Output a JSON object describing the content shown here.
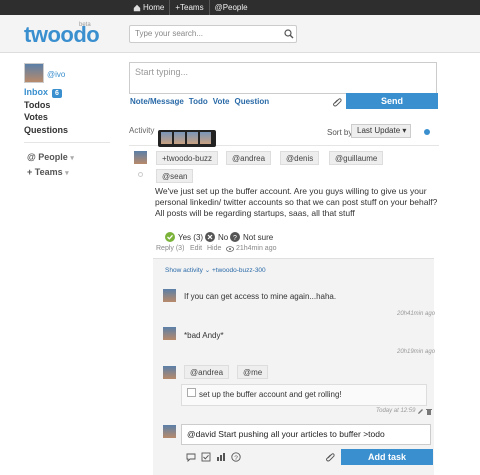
{
  "topnav": {
    "home": "Home",
    "teams": "+Teams",
    "people": "@People"
  },
  "header": {
    "logo": "twoodo",
    "beta": "beta",
    "search_placeholder": "Type your search..."
  },
  "user": {
    "handle": "@ivo"
  },
  "sidebar": {
    "inbox_label": "Inbox",
    "inbox_count": "6",
    "items": [
      "Todos",
      "Votes",
      "Questions"
    ],
    "people": "@ People",
    "teams": "+ Teams",
    "arrow": "▾"
  },
  "composer": {
    "placeholder": "Start typing...",
    "tabs": [
      "Note/Message",
      "Todo",
      "Vote",
      "Question"
    ],
    "send": "Send"
  },
  "activity": {
    "label": "Activity",
    "sort_label": "Sort by:",
    "sort_value": "Last Update ▾"
  },
  "post": {
    "tags": [
      "+twoodo-buzz",
      "@andrea",
      "@denis",
      "@guillaume",
      "@sean"
    ],
    "text": "We've just set up the buffer account. Are you guys willing to give us your personal linkedin/ twitter accounts so that we can post stuff on your behalf? All posts will be regarding startups, saas, all that stuff",
    "votes": {
      "yes": "Yes (3)",
      "no": "No",
      "not_sure": "Not sure"
    },
    "meta": {
      "reply": "Reply (3)",
      "edit": "Edit",
      "hide": "Hide",
      "time": "21h4min ago"
    }
  },
  "thread": {
    "show_activity": "Show activity",
    "show_activity_tag": "+twoodo-buzz-300",
    "comments": [
      {
        "text": "If you can get access to mine again...haha.",
        "time": "20h41min ago"
      },
      {
        "text": "*bad Andy*",
        "time": "20h19min ago"
      }
    ],
    "task": {
      "tag1": "@andrea",
      "tag2": "@me",
      "text": "set up the buffer account and get rolling!",
      "time": "Today at 12:59"
    },
    "reply_value": "@david Start pushing all your articles to buffer >todo",
    "add_task": "Add task"
  },
  "colors": {
    "brand": "#3a8fcf",
    "topbar": "#2e2e2e"
  }
}
